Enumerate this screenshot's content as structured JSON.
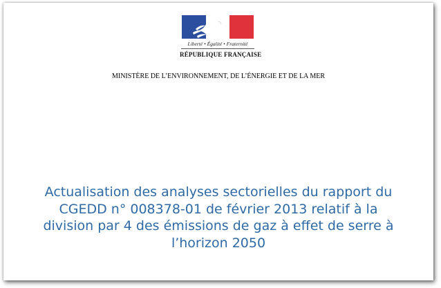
{
  "header": {
    "logo": {
      "motto": "Liberté • Égalité • Fraternité",
      "republic": "RÉPUBLIQUE FRANÇAISE",
      "colors": {
        "blue": "#2b4f9e",
        "white": "#ffffff",
        "red": "#e0323a"
      }
    },
    "ministry": "MINISTÈRE DE L’ENVIRONNEMENT, DE L’ÉNERGIE ET DE LA MER"
  },
  "title": {
    "lines": [
      "Actualisation des analyses sectorielles du rapport du",
      "CGEDD n° 008378-01 de février 2013 relatif à la",
      "division par 4 des émissions de gaz à effet de serre à",
      "l’horizon 2050"
    ],
    "color": "#2e6aa6"
  }
}
